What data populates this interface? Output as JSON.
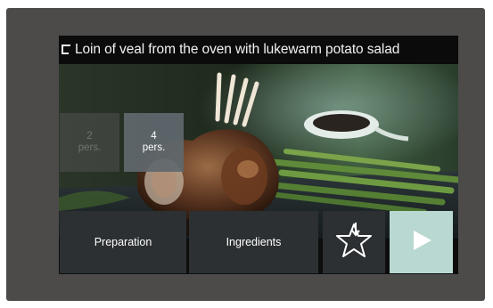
{
  "header": {
    "title": "Loin of veal from the oven with lukewarm potato salad",
    "back_icon": "back-bracket-icon"
  },
  "servings": {
    "options": [
      {
        "number": "2",
        "unit": "pers.",
        "selected": false
      },
      {
        "number": "4",
        "unit": "pers.",
        "selected": true
      }
    ]
  },
  "bottom_bar": {
    "preparation_label": "Preparation",
    "ingredients_label": "Ingredients",
    "favorite_icon": "star-add-icon",
    "start_icon": "play-icon"
  },
  "colors": {
    "device_bezel": "#4d4b4a",
    "screen_bg": "#0d0d0d",
    "tab_bg": "#2c3033",
    "play_bg": "#b8d8d1",
    "selected_serving_bg": "#5f686e"
  }
}
